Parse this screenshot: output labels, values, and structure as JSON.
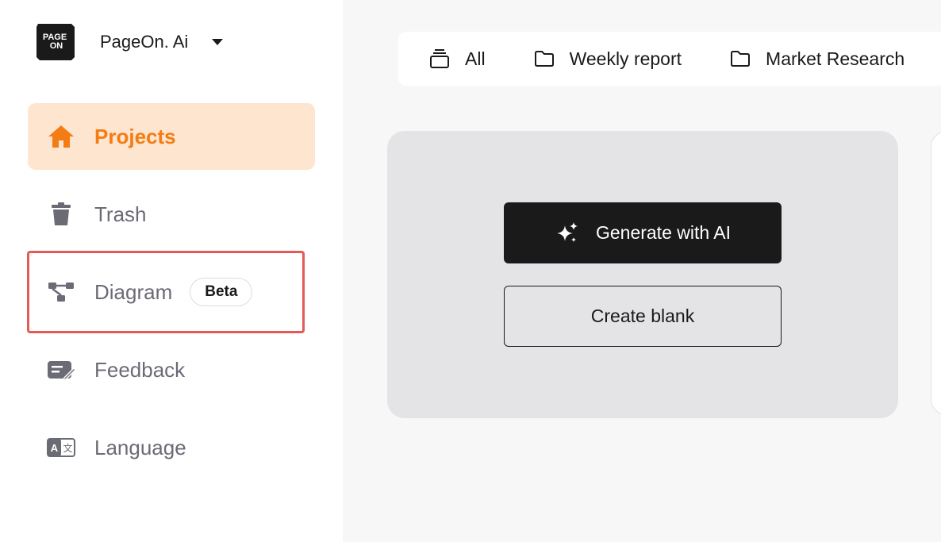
{
  "brand": {
    "logo_text_top": "PAGE",
    "logo_text_bottom": "ON",
    "name": "PageOn. Ai"
  },
  "sidebar": {
    "items": [
      {
        "label": "Projects",
        "icon": "home-icon",
        "active": true
      },
      {
        "label": "Trash",
        "icon": "trash-icon"
      },
      {
        "label": "Diagram",
        "icon": "diagram-icon",
        "badge": "Beta"
      },
      {
        "label": "Feedback",
        "icon": "feedback-icon"
      },
      {
        "label": "Language",
        "icon": "language-icon"
      }
    ]
  },
  "tabs": [
    {
      "label": "All",
      "icon": "stack-icon"
    },
    {
      "label": "Weekly report",
      "icon": "folder-icon"
    },
    {
      "label": "Market Research",
      "icon": "folder-icon"
    }
  ],
  "create_card": {
    "generate_label": "Generate with AI",
    "blank_label": "Create blank"
  },
  "colors": {
    "accent": "#f47c14",
    "active_bg": "#fde5cf",
    "highlight": "#e35a57",
    "dark_button": "#1a1a1a"
  }
}
